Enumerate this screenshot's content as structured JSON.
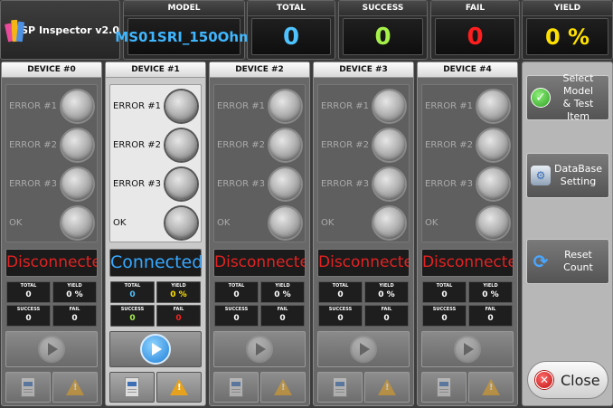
{
  "app": {
    "title": "TSP Inspector v2.0"
  },
  "header": {
    "model": {
      "label": "MODEL",
      "value": "MS01SRI_150Ohm",
      "color": "#3fb7ff"
    },
    "total": {
      "label": "TOTAL",
      "value": "0",
      "color": "#4fc3ff"
    },
    "success": {
      "label": "SUCCESS",
      "value": "0",
      "color": "#a6f04a"
    },
    "fail": {
      "label": "FAIL",
      "value": "0",
      "color": "#ff1e1e"
    },
    "yield": {
      "label": "YIELD",
      "value": "0 %",
      "color": "#ffe100"
    }
  },
  "device_labels": {
    "error1": "ERROR #1",
    "error2": "ERROR #2",
    "error3": "ERROR #3",
    "ok": "OK",
    "total": "TOTAL",
    "yield": "YIELD",
    "success": "SUCCESS",
    "fail": "FAIL"
  },
  "devices": [
    {
      "title": "DEVICE #0",
      "status": "Disconnected",
      "total": "0",
      "yield": "0 %",
      "success": "0",
      "fail": "0"
    },
    {
      "title": "DEVICE #1",
      "status": "Connected",
      "total": "0",
      "yield": "0 %",
      "success": "0",
      "fail": "0"
    },
    {
      "title": "DEVICE #2",
      "status": "Disconnected",
      "total": "0",
      "yield": "0 %",
      "success": "0",
      "fail": "0"
    },
    {
      "title": "DEVICE #3",
      "status": "Disconnected",
      "total": "0",
      "yield": "0 %",
      "success": "0",
      "fail": "0"
    },
    {
      "title": "DEVICE #4",
      "status": "Disconnected",
      "total": "0",
      "yield": "0 %",
      "success": "0",
      "fail": "0"
    }
  ],
  "active_device_colors": {
    "total": "#4fc3ff",
    "yield": "#ffe100",
    "success": "#a6f04a",
    "fail": "#ff1e1e"
  },
  "side": {
    "select_model": {
      "line1": "Select Model",
      "line2": "& Test Item"
    },
    "database": {
      "line1": "DataBase",
      "line2": "Setting"
    },
    "reset": {
      "line1": "Reset",
      "line2": "Count"
    },
    "close": "Close"
  }
}
